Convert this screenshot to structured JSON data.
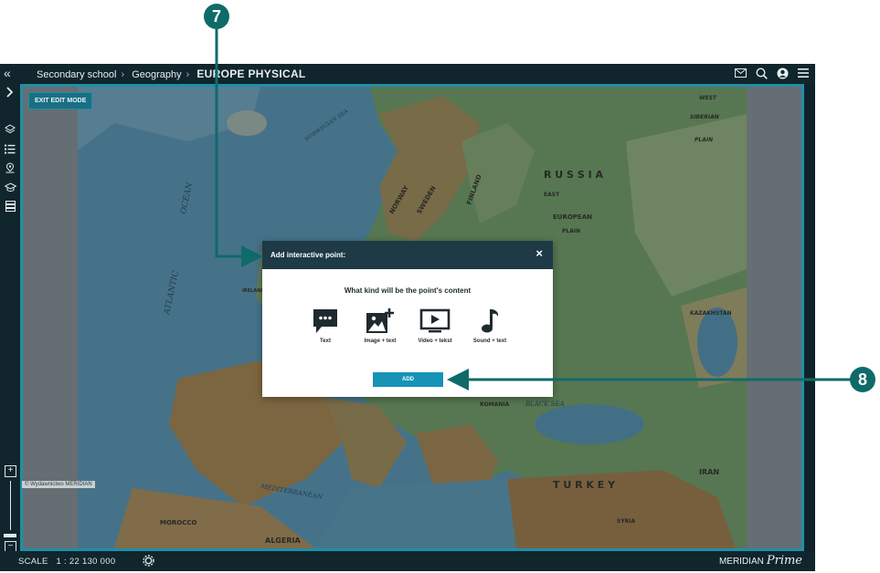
{
  "topbar": {
    "breadcrumb": [
      "Secondary school",
      "Geography"
    ],
    "title": "EUROPE PHYSICAL"
  },
  "map": {
    "edit_button": "EXIT EDIT MODE",
    "labels": [
      "ATLANTIC",
      "OCEAN",
      "NORWEGIAN SEA",
      "NORWAY",
      "SWEDEN",
      "FINLAND",
      "R U S S I A",
      "EAST",
      "EUROPEAN",
      "PLAIN",
      "KAZAKHSTAN",
      "IRELAND",
      "ROMANIA",
      "BLACK SEA",
      "T U R K E Y",
      "IRAN",
      "SYRIA",
      "MEDITERRANEAN",
      "MOROCCO",
      "ALGERIA",
      "WEST",
      "SIBERIAN",
      "PLAIN"
    ],
    "copyright": "© Wydawnictwo MERIDIAN"
  },
  "modal": {
    "title": "Add interactive point:",
    "close": "×",
    "question": "What kind will be the point's content",
    "options": [
      {
        "label": "Text",
        "icon": "chat-bubble-icon"
      },
      {
        "label": "Image + text",
        "icon": "image-add-icon"
      },
      {
        "label": "Video + tekst",
        "icon": "video-play-icon"
      },
      {
        "label": "Sound + text",
        "icon": "music-note-icon"
      }
    ],
    "add_button": "ADD"
  },
  "bottombar": {
    "scale_label": "SCALE",
    "scale_value": "1 : 22 130 000",
    "logo": "MERIDIAN",
    "logo_script": "Prime"
  },
  "callouts": {
    "first": "7",
    "second": "8"
  },
  "colors": {
    "accent": "#1f8fa7",
    "callout": "#0f6a6a",
    "add_button": "#1793b8",
    "modal_header": "#1d3a46"
  }
}
